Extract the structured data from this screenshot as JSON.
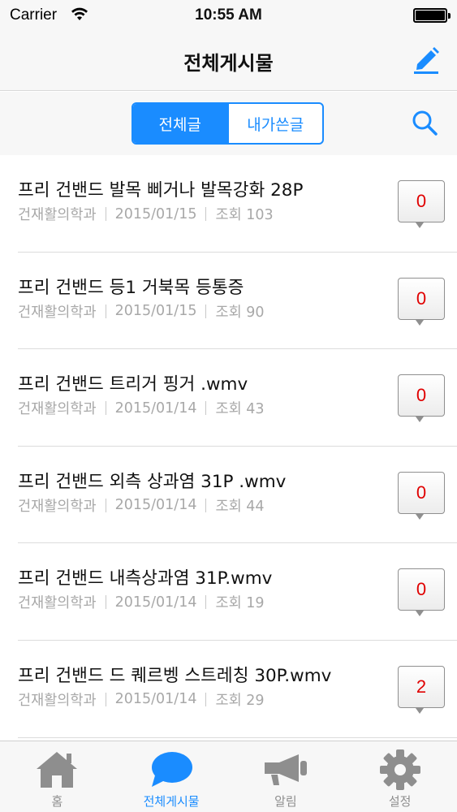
{
  "status_bar": {
    "carrier": "Carrier",
    "time": "10:55 AM"
  },
  "nav": {
    "title": "전체게시물",
    "compose_icon": "pencil-icon"
  },
  "segment": {
    "all_label": "전체글",
    "mine_label": "내가쓴글",
    "selected": "전체글",
    "search_icon": "search-icon"
  },
  "posts": [
    {
      "title": "프리 건밴드 발목 삐거나 발목강화 28P",
      "author": "건재활의학과",
      "date": "2015/01/15",
      "views": "조회 103",
      "comments": "0"
    },
    {
      "title": "프리 건밴드 등1 거북목 등통증",
      "author": "건재활의학과",
      "date": "2015/01/15",
      "views": "조회 90",
      "comments": "0"
    },
    {
      "title": "프리 건밴드 트리거 핑거 .wmv",
      "author": "건재활의학과",
      "date": "2015/01/14",
      "views": "조회 43",
      "comments": "0"
    },
    {
      "title": "프리 건밴드 외측 상과염 31P .wmv",
      "author": "건재활의학과",
      "date": "2015/01/14",
      "views": "조회 44",
      "comments": "0"
    },
    {
      "title": "프리 건밴드 내측상과염 31P.wmv",
      "author": "건재활의학과",
      "date": "2015/01/14",
      "views": "조회 19",
      "comments": "0"
    },
    {
      "title": "프리 건밴드 드 퀘르벵 스트레칭 30P.wmv",
      "author": "건재활의학과",
      "date": "2015/01/14",
      "views": "조회 29",
      "comments": "2"
    }
  ],
  "tabs": [
    {
      "label": "홈",
      "icon": "home-icon",
      "active": false
    },
    {
      "label": "전체게시물",
      "icon": "chat-bubble-icon",
      "active": true
    },
    {
      "label": "알림",
      "icon": "megaphone-icon",
      "active": false
    },
    {
      "label": "설정",
      "icon": "gear-icon",
      "active": false
    }
  ],
  "colors": {
    "accent": "#1a8cff",
    "badge_text": "#e00000",
    "meta_text": "#a8a8a8",
    "inactive_tab": "#8e8e8e"
  }
}
